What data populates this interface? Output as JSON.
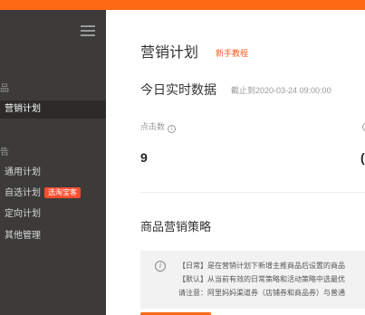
{
  "sidebar": {
    "section1": "品",
    "active_item": "营销计划",
    "section2": "告",
    "items": [
      {
        "label": "通用计划"
      },
      {
        "label": "自选计划",
        "badge": "选淘宝客"
      },
      {
        "label": "定向计划"
      },
      {
        "label": "其他管理"
      }
    ]
  },
  "main": {
    "title": "营销计划",
    "guide_link": "新手教程",
    "realtime_title": "今日实时数据",
    "as_of": "截止到2020-03-24 09:00:00",
    "metric1": {
      "label": "点击数",
      "value": "9"
    },
    "metric2": {
      "label": "",
      "value": "("
    },
    "strategy_title": "商品营销策略",
    "notice": {
      "icon": "info-icon",
      "line1": "【日常】是在营销计划下新增主推商品后设置的商品",
      "line2": "【默认】从当前有效的日常策略和活动策略中选最优",
      "line3": "请注意：阿里妈妈渠道券（店铺券和商品券）与普通"
    }
  },
  "colors": {
    "accent": "#ff6a17",
    "sidebar_bg": "#3c3b3a",
    "badge": "#ff4d2e",
    "link": "#ff5a1f"
  }
}
